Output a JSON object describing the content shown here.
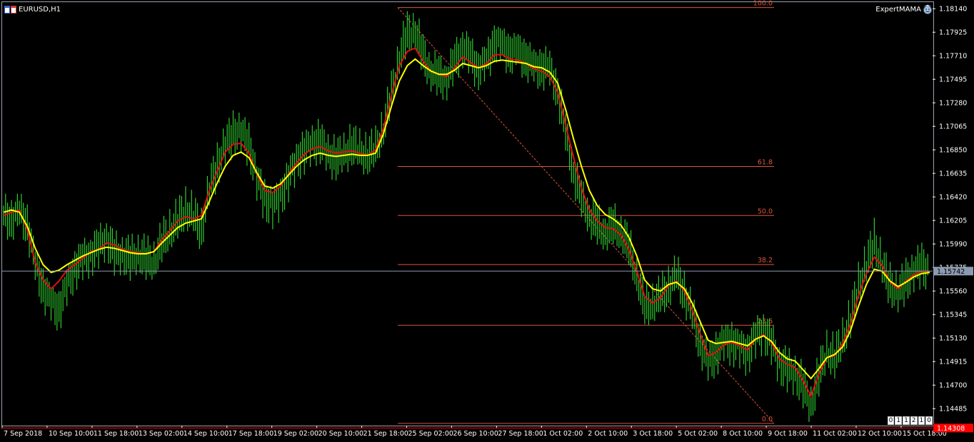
{
  "header": {
    "symbol": "EURUSD,H1",
    "expert": "ExpertMAMA"
  },
  "colors": {
    "background": "#000000",
    "candles": "#2ecc2e",
    "ma_fast": "#e01010",
    "ma_slow": "#ffff00",
    "fibo": "#d9553b",
    "grid_line": "#8c9bb0",
    "bid_tag": "#8c9bb0",
    "ask_tag": "#ff0000"
  },
  "icons": [
    "window-icon",
    "expert-smiley-icon"
  ],
  "scale_fix": [
    "0",
    "1",
    "1",
    "2",
    "1",
    "0"
  ],
  "chart_data": {
    "type": "line",
    "title": "EURUSD,H1",
    "ylim": [
      1.1433,
      1.182
    ],
    "y_ticks": [
      "1.18140",
      "1.17925",
      "1.17710",
      "1.17495",
      "1.17280",
      "1.17065",
      "1.16850",
      "1.16635",
      "1.16420",
      "1.16205",
      "1.15990",
      "1.15775",
      "1.15560",
      "1.15345",
      "1.15130",
      "1.14915",
      "1.14700",
      "1.14485"
    ],
    "x_ticks": [
      "7 Sep 2018",
      "10 Sep 10:00",
      "11 Sep 18:00",
      "13 Sep 02:00",
      "14 Sep 10:00",
      "17 Sep 18:00",
      "19 Sep 02:00",
      "20 Sep 10:00",
      "21 Sep 18:00",
      "25 Sep 02:00",
      "26 Sep 10:00",
      "27 Sep 18:00",
      "1 Oct 02:00",
      "2 Oct 10:00",
      "3 Oct 18:00",
      "5 Oct 02:00",
      "8 Oct 10:00",
      "9 Oct 18:00",
      "11 Oct 02:00",
      "12 Oct 10:00",
      "15 Oct 18:00"
    ],
    "current_price": "1.15742",
    "low_price_tag": "1.14308",
    "fibonacci": {
      "start_price": 1.1815,
      "end_price": 1.1435,
      "levels": [
        {
          "label": "100.0",
          "ratio": 1.0
        },
        {
          "label": "61.8",
          "ratio": 0.618
        },
        {
          "label": "50.0",
          "ratio": 0.5
        },
        {
          "label": "38.2",
          "ratio": 0.382
        },
        {
          "label": "23.6",
          "ratio": 0.236
        },
        {
          "label": "0.0",
          "ratio": 0.0
        }
      ]
    },
    "series": [
      {
        "role": "price-close",
        "values": [
          1.1625,
          1.1622,
          1.1628,
          1.1618,
          1.158,
          1.156,
          1.1545,
          1.154,
          1.156,
          1.1578,
          1.1585,
          1.159,
          1.1596,
          1.1605,
          1.159,
          1.159,
          1.1585,
          1.159,
          1.1585,
          1.1582,
          1.16,
          1.161,
          1.162,
          1.163,
          1.1625,
          1.161,
          1.165,
          1.167,
          1.169,
          1.17,
          1.1702,
          1.169,
          1.166,
          1.164,
          1.1635,
          1.1642,
          1.166,
          1.1675,
          1.1685,
          1.169,
          1.1694,
          1.168,
          1.1678,
          1.168,
          1.169,
          1.1683,
          1.168,
          1.1685,
          1.1705,
          1.1735,
          1.177,
          1.179,
          1.1795,
          1.177,
          1.1757,
          1.1752,
          1.175,
          1.1765,
          1.178,
          1.177,
          1.176,
          1.1765,
          1.1785,
          1.178,
          1.1775,
          1.1775,
          1.177,
          1.176,
          1.1762,
          1.1758,
          1.174,
          1.17,
          1.1665,
          1.164,
          1.1625,
          1.1615,
          1.161,
          1.1615,
          1.161,
          1.1595,
          1.157,
          1.154,
          1.1545,
          1.155,
          1.156,
          1.157,
          1.1555,
          1.1535,
          1.151,
          1.149,
          1.15,
          1.151,
          1.151,
          1.1505,
          1.15,
          1.1515,
          1.152,
          1.151,
          1.149,
          1.1485,
          1.148,
          1.147,
          1.145,
          1.148,
          1.15,
          1.1495,
          1.151,
          1.153,
          1.156,
          1.158,
          1.16,
          1.158,
          1.156,
          1.1555,
          1.1565,
          1.1575,
          1.158,
          1.1574
        ]
      },
      {
        "role": "ma-fast",
        "values": [
          1.1625,
          1.1628,
          1.163,
          1.1612,
          1.1582,
          1.1566,
          1.1558,
          1.1565,
          1.1575,
          1.158,
          1.1586,
          1.1592,
          1.1594,
          1.16,
          1.1598,
          1.1594,
          1.1592,
          1.1591,
          1.159,
          1.1592,
          1.1603,
          1.1611,
          1.162,
          1.1624,
          1.1622,
          1.1625,
          1.1648,
          1.1666,
          1.1683,
          1.169,
          1.1691,
          1.1682,
          1.1663,
          1.1648,
          1.1646,
          1.1652,
          1.1663,
          1.1673,
          1.1681,
          1.1686,
          1.1688,
          1.1684,
          1.1682,
          1.1683,
          1.1684,
          1.1682,
          1.168,
          1.1685,
          1.1705,
          1.1735,
          1.1762,
          1.1775,
          1.1778,
          1.1766,
          1.1757,
          1.1754,
          1.1752,
          1.176,
          1.177,
          1.1765,
          1.176,
          1.1764,
          1.1772,
          1.1772,
          1.1768,
          1.1767,
          1.1764,
          1.1759,
          1.1757,
          1.1752,
          1.1738,
          1.1708,
          1.1678,
          1.165,
          1.163,
          1.162,
          1.1614,
          1.1613,
          1.1607,
          1.1594,
          1.1574,
          1.1551,
          1.1545,
          1.155,
          1.1561,
          1.1565,
          1.1556,
          1.1538,
          1.1517,
          1.1497,
          1.15,
          1.1507,
          1.1509,
          1.1506,
          1.1502,
          1.1512,
          1.1516,
          1.1509,
          1.1494,
          1.1489,
          1.1486,
          1.1474,
          1.146,
          1.148,
          1.1495,
          1.1497,
          1.1508,
          1.1526,
          1.1552,
          1.1572,
          1.1587,
          1.1579,
          1.1564,
          1.1558,
          1.1565,
          1.1571,
          1.1574,
          1.1574
        ]
      },
      {
        "role": "ma-slow",
        "values": [
          1.1628,
          1.163,
          1.1628,
          1.1615,
          1.1595,
          1.158,
          1.1573,
          1.1575,
          1.158,
          1.1584,
          1.1588,
          1.1591,
          1.1594,
          1.1596,
          1.1595,
          1.1593,
          1.1591,
          1.159,
          1.159,
          1.1592,
          1.16,
          1.1607,
          1.1614,
          1.1618,
          1.162,
          1.1622,
          1.1638,
          1.1655,
          1.167,
          1.168,
          1.1683,
          1.1678,
          1.1664,
          1.1652,
          1.165,
          1.1654,
          1.1662,
          1.167,
          1.1676,
          1.168,
          1.1682,
          1.168,
          1.1679,
          1.168,
          1.1681,
          1.168,
          1.168,
          1.1682,
          1.17,
          1.1725,
          1.1748,
          1.1762,
          1.1768,
          1.1762,
          1.1757,
          1.1754,
          1.1754,
          1.1758,
          1.1764,
          1.1762,
          1.176,
          1.1762,
          1.1766,
          1.1767,
          1.1766,
          1.1765,
          1.1764,
          1.1761,
          1.176,
          1.1756,
          1.1746,
          1.1722,
          1.1695,
          1.167,
          1.1648,
          1.1634,
          1.1626,
          1.1622,
          1.1616,
          1.1605,
          1.1588,
          1.1566,
          1.1558,
          1.1556,
          1.1562,
          1.1564,
          1.1558,
          1.1545,
          1.1528,
          1.1511,
          1.1508,
          1.1509,
          1.151,
          1.1508,
          1.1506,
          1.1512,
          1.1515,
          1.151,
          1.15,
          1.1494,
          1.1492,
          1.1484,
          1.1476,
          1.1485,
          1.1495,
          1.1498,
          1.1505,
          1.152,
          1.1542,
          1.1562,
          1.1576,
          1.1574,
          1.1565,
          1.156,
          1.1564,
          1.1569,
          1.1572,
          1.1573
        ]
      }
    ]
  }
}
